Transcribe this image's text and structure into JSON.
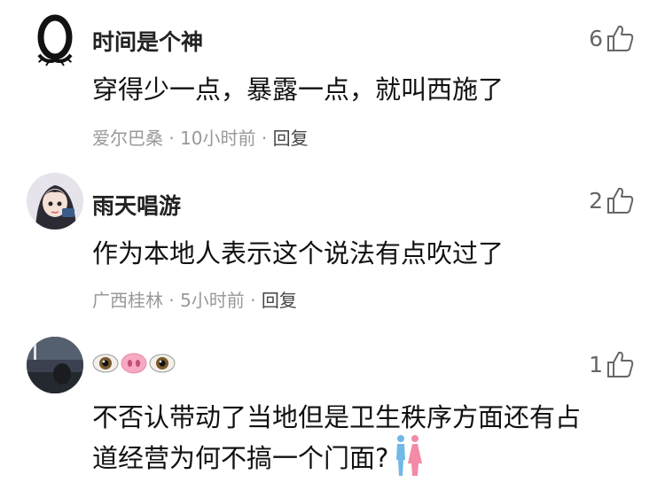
{
  "comments": [
    {
      "username": "时间是个神",
      "likes": "6",
      "content": "穿得少一点，暴露一点，就叫西施了",
      "location": "爱尔巴桑",
      "time": "10小时前",
      "reply_label": "回复",
      "separator": "·"
    },
    {
      "username": "雨天唱游",
      "likes": "2",
      "content": "作为本地人表示这个说法有点吹过了",
      "location": "广西桂林",
      "time": "5小时前",
      "reply_label": "回复",
      "separator": "·"
    },
    {
      "username_emojis": [
        "eye-emoji",
        "pig-nose-emoji",
        "eye-emoji"
      ],
      "likes": "1",
      "content_line1": "不否认带动了当地但是卫生秩序方面还有占",
      "content_line2": "道经营为何不搞一个门面?"
    }
  ],
  "colors": {
    "meta": "#999999",
    "like": "#666666",
    "text": "#111111"
  }
}
